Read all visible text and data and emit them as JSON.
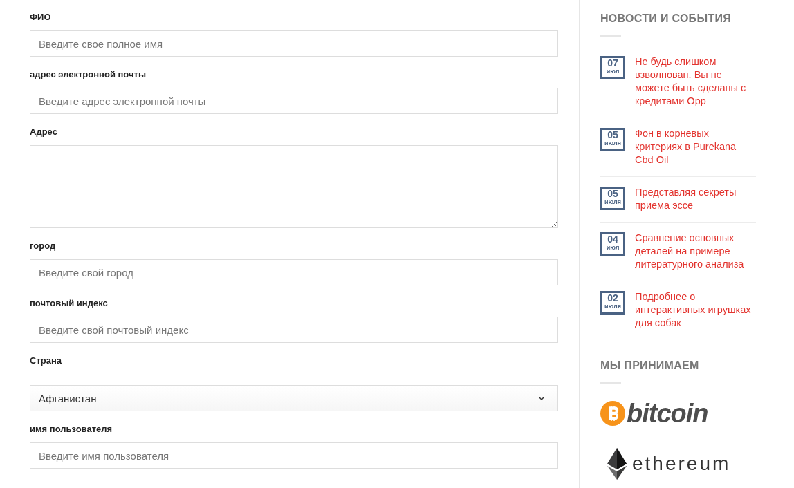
{
  "form": {
    "fields": [
      {
        "kind": "input",
        "label": "ФИО",
        "placeholder": "Введите свое полное имя"
      },
      {
        "kind": "input",
        "label": "адрес электронной почты",
        "placeholder": "Введите адрес электронной почты"
      },
      {
        "kind": "textarea",
        "label": "Адрес"
      },
      {
        "kind": "input",
        "label": "город",
        "placeholder": "Введите свой город"
      },
      {
        "kind": "input",
        "label": "почтовый индекс",
        "placeholder": "Введите свой почтовый индекс"
      },
      {
        "kind": "select",
        "label": "Страна",
        "value": "Афганистан"
      },
      {
        "kind": "input",
        "label": "имя пользователя",
        "placeholder": "Введите имя пользователя"
      }
    ]
  },
  "sidebar": {
    "news": {
      "title": "НОВОСТИ И СОБЫТИЯ",
      "items": [
        {
          "day": "07",
          "month": "июл",
          "title": "Не будь слишком взволнован. Вы не можете быть сделаны с кредитами Opp"
        },
        {
          "day": "05",
          "month": "июля",
          "title": "Фон в корневых критериях в Purekana Cbd Oil"
        },
        {
          "day": "05",
          "month": "июля",
          "title": "Представляя секреты приема эссе"
        },
        {
          "day": "04",
          "month": "июл",
          "title": "Сравнение основных деталей на примере литературного анализа"
        },
        {
          "day": "02",
          "month": "июля",
          "title": "Подробнее о интерактивных игрушках для собак"
        }
      ]
    },
    "payments": {
      "title": "МЫ ПРИНИМАЕМ",
      "logos": [
        {
          "kind": "bitcoin",
          "text": "bitcoin"
        },
        {
          "kind": "ethereum",
          "text": "ethereum"
        }
      ]
    }
  }
}
